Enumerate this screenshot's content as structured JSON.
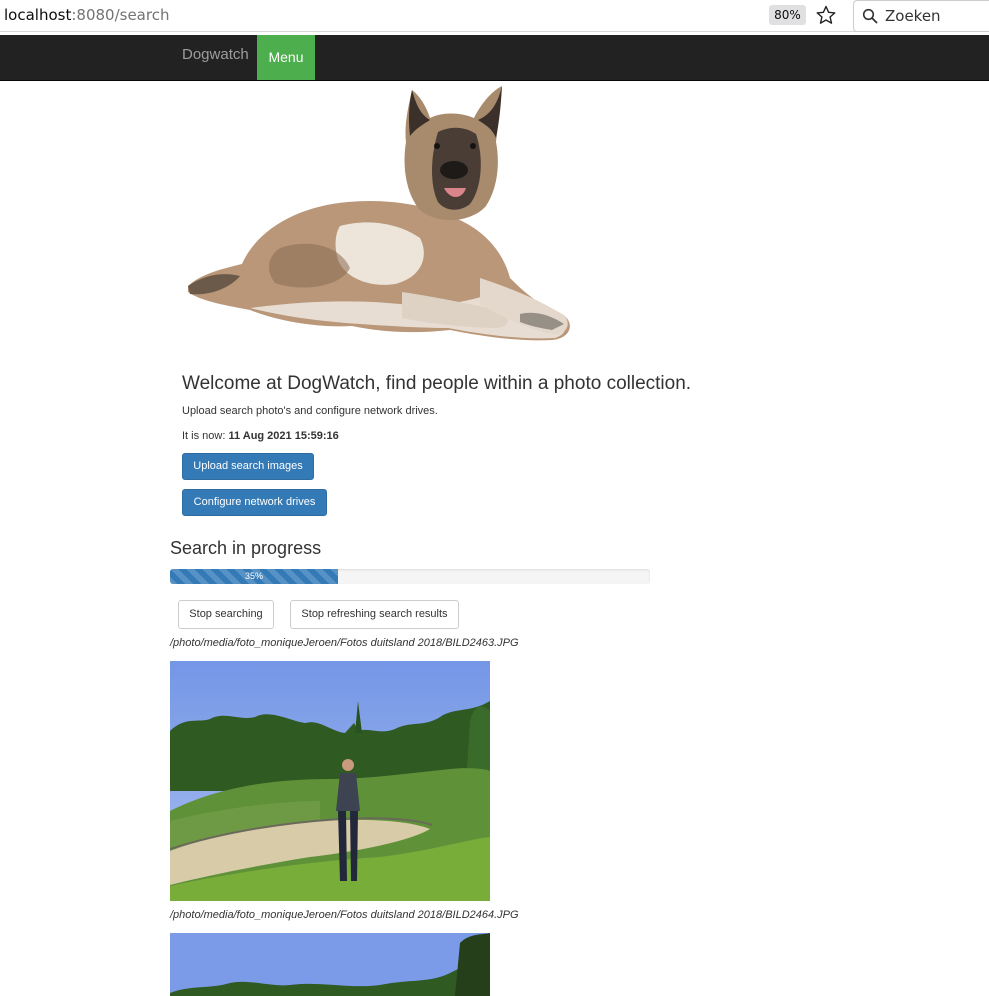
{
  "browser": {
    "url_host": "localhost",
    "url_path": ":8080/search",
    "zoom": "80%",
    "search_placeholder": "Zoeken"
  },
  "navbar": {
    "brand": "Dogwatch",
    "menu_label": "Menu"
  },
  "welcome": {
    "heading": "Welcome at DogWatch, find people within a photo collection.",
    "subtext": "Upload search photo's and configure network drives.",
    "now_label": "It is now: ",
    "now_value": "11 Aug 2021 15:59:16"
  },
  "actions": {
    "upload_label": "Upload search images",
    "configure_label": "Configure network drives"
  },
  "search": {
    "heading": "Search in progress",
    "progress": 35,
    "progress_text": "35%",
    "stop_label": "Stop searching",
    "stop_refresh_label": "Stop refreshing search results"
  },
  "results": [
    {
      "path": "/photo/media/foto_moniqueJeroen/Fotos duitsland 2018/BILD2463.JPG"
    },
    {
      "path": "/photo/media/foto_moniqueJeroen/Fotos duitsland 2018/BILD2464.JPG"
    }
  ]
}
